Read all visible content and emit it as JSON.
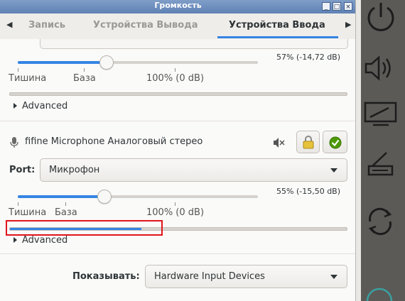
{
  "window": {
    "title": "Громкость",
    "controls": [
      "_",
      "□",
      "×"
    ]
  },
  "tabs": {
    "items": [
      "Запись",
      "Устройства Вывода",
      "Устройства Ввода"
    ],
    "active_index": 2
  },
  "device1": {
    "volume_text": "57% (-14,72 dB)",
    "volume_fraction": 0.37,
    "marks": {
      "silence": "Тишина",
      "base": "База",
      "unity": "100% (0 dB)"
    },
    "advanced": "Advanced"
  },
  "device2": {
    "name": "fifine Microphone Аналоговый стерео",
    "port_label": "Port:",
    "port_value": "Микрофон",
    "volume_text": "55% (-15,50 dB)",
    "volume_fraction": 0.36,
    "marks": {
      "silence": "Тишина",
      "base": "База",
      "unity": "100% (0 dB)"
    },
    "level_fraction": 0.39,
    "advanced": "Advanced"
  },
  "footer": {
    "show_label": "Показывать:",
    "show_value": "Hardware Input Devices"
  },
  "colors": {
    "accent": "#3584e4",
    "highlight": "#e0141b"
  }
}
